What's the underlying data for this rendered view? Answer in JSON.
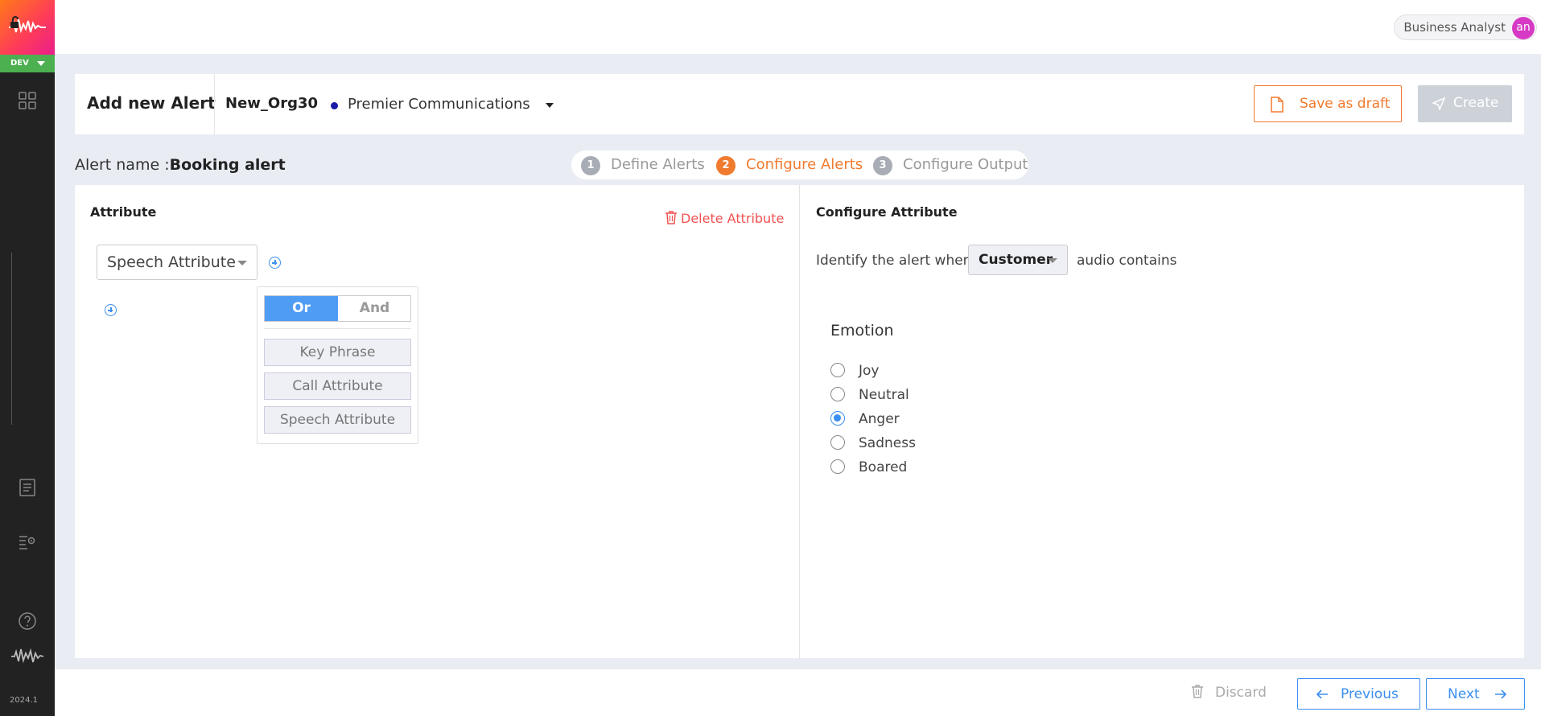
{
  "sidebar": {
    "env_label": "DEV",
    "version": "2024.1"
  },
  "topbar": {
    "role": "Business Analyst",
    "avatar_initials": "an"
  },
  "header": {
    "title": "Add new Alert",
    "org": "New_Org30",
    "company": "Premier Communications",
    "save_draft_label": "Save as draft",
    "create_label": "Create"
  },
  "alert": {
    "name_label": "Alert name :",
    "name_value": "Booking alert"
  },
  "steps": [
    {
      "num": "1",
      "label": "Define Alerts",
      "state": "inactive"
    },
    {
      "num": "2",
      "label": "Configure Alerts",
      "state": "active"
    },
    {
      "num": "3",
      "label": "Configure Output",
      "state": "inactive"
    }
  ],
  "attribute_panel": {
    "title": "Attribute",
    "delete_label": "Delete Attribute",
    "selected_attribute": "Speech Attribute",
    "toggle": {
      "or_label": "Or",
      "and_label": "And",
      "selected": "Or"
    },
    "menu_items": [
      "Key Phrase",
      "Call Attribute",
      "Speech Attribute"
    ]
  },
  "configure_panel": {
    "title": "Configure Attribute",
    "identify_prefix": "Identify the alert when",
    "speaker": "Customer",
    "identify_suffix": "audio contains",
    "emotion_title": "Emotion",
    "emotions": [
      "Joy",
      "Neutral",
      "Anger",
      "Sadness",
      "Boared"
    ],
    "selected_emotion": "Anger"
  },
  "footer": {
    "discard_label": "Discard",
    "previous_label": "Previous",
    "next_label": "Next"
  },
  "colors": {
    "accent_orange": "#f07a2e",
    "accent_blue": "#3b8ff0",
    "env_green": "#4caf50",
    "sidebar_bg": "#222222",
    "danger_red": "#f05252"
  }
}
